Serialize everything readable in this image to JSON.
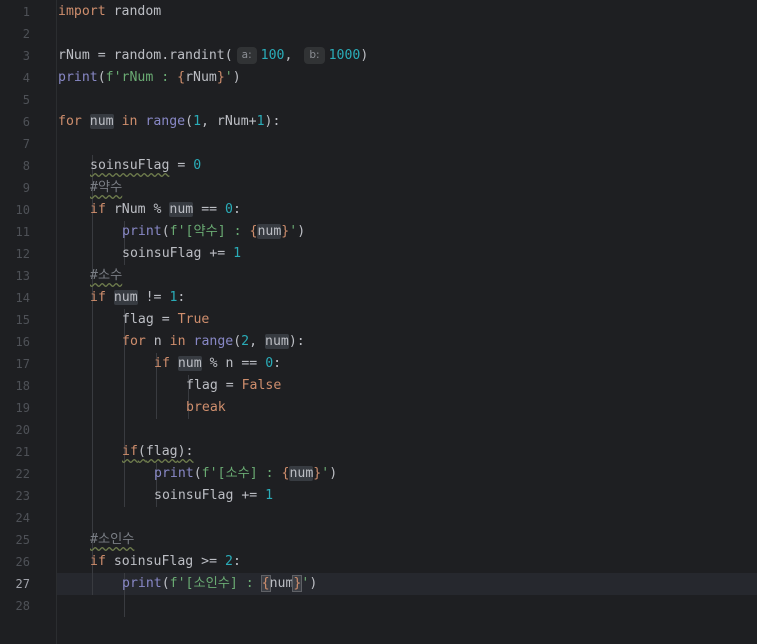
{
  "editor": {
    "active_line": 27,
    "line_numbers": [
      "1",
      "2",
      "3",
      "4",
      "5",
      "6",
      "7",
      "8",
      "9",
      "10",
      "11",
      "12",
      "13",
      "14",
      "15",
      "16",
      "17",
      "18",
      "19",
      "20",
      "21",
      "22",
      "23",
      "24",
      "25",
      "26",
      "27",
      "28"
    ]
  },
  "code": {
    "l1": {
      "kw": "import",
      "rest": " random"
    },
    "l3": {
      "a": "rNum = random.randint(",
      "hint_a": "a:",
      "v1": "100",
      "sep": ", ",
      "hint_b": "b:",
      "v2": "1000",
      "close": ")"
    },
    "l4": {
      "fn": "print",
      "p1": "(",
      "s1": "f'rNum : ",
      "b1": "{",
      "v": "rNum",
      "b2": "}",
      "s2": "'",
      "p2": ")"
    },
    "l6": {
      "kw1": "for",
      "sp1": " ",
      "var": "num",
      "sp2": " ",
      "kw2": "in",
      "sp3": " ",
      "fn": "range",
      "p1": "(",
      "n1": "1",
      "mid": ", rNum+",
      "n2": "1",
      "p2": "):"
    },
    "l8": {
      "var": "soinsuFlag",
      "eq": " = ",
      "n": "0"
    },
    "l9": {
      "c": "#약수"
    },
    "l10": {
      "kw": "if",
      "a": " rNum % ",
      "var": "num",
      "b": " == ",
      "n": "0",
      "c": ":"
    },
    "l11": {
      "fn": "print",
      "p1": "(",
      "s1": "f'[약수] : ",
      "b1": "{",
      "v": "num",
      "b2": "}",
      "s2": "'",
      "p2": ")"
    },
    "l12": {
      "a": "soinsuFlag += ",
      "n": "1"
    },
    "l13": {
      "c": "#소수"
    },
    "l14": {
      "kw": "if",
      "sp": " ",
      "var": "num",
      "b": " != ",
      "n": "1",
      "c": ":"
    },
    "l15": {
      "a": "flag = ",
      "kw": "True"
    },
    "l16": {
      "kw1": "for",
      "a": " n ",
      "kw2": "in",
      "sp": " ",
      "fn": "range",
      "p1": "(",
      "n": "2",
      "sep": ", ",
      "var": "num",
      "p2": "):"
    },
    "l17": {
      "kw": "if",
      "sp": " ",
      "var": "num",
      "b": " % n == ",
      "n": "0",
      "c": ":"
    },
    "l18": {
      "a": "flag = ",
      "kw": "False"
    },
    "l19": {
      "kw": "break"
    },
    "l21": {
      "kw": "if",
      "a": "(",
      "var": "flag",
      "b": "):"
    },
    "l22": {
      "fn": "print",
      "p1": "(",
      "s1": "f'[소수] : ",
      "b1": "{",
      "v": "num",
      "b2": "}",
      "s2": "'",
      "p2": ")"
    },
    "l23": {
      "a": "soinsuFlag += ",
      "n": "1"
    },
    "l25": {
      "c": "#소인수"
    },
    "l26": {
      "kw": "if",
      "a": " soinsuFlag >= ",
      "n": "2",
      "c": ":"
    },
    "l27": {
      "fn": "print",
      "p1": "(",
      "s1": "f'[소인수] : ",
      "b1": "{",
      "v": "num",
      "b2": "}",
      "s2": "'",
      "p2": ")"
    }
  }
}
